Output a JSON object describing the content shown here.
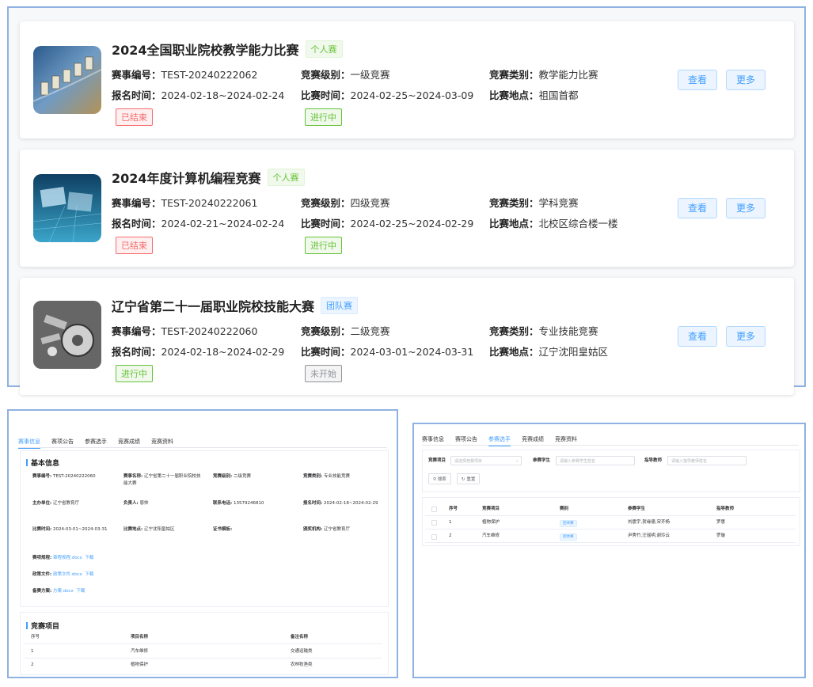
{
  "cards": [
    {
      "title": "2024全国职业院校教学能力比赛",
      "type_tag": "个人赛",
      "code_label": "赛事编号：",
      "code": "TEST-20240222062",
      "level_label": "竞赛级别：",
      "level": "一级竞赛",
      "category_label": "竞赛类别：",
      "category": "教学能力比赛",
      "reg_label": "报名时间：",
      "reg_time": "2024-02-18~2024-02-24",
      "match_label": "比赛时间：",
      "match_time": "2024-02-25~2024-03-09",
      "place_label": "比赛地点：",
      "place": "祖国首都",
      "reg_status": "已结束",
      "match_status": "进行中",
      "view_label": "查看",
      "more_label": "更多"
    },
    {
      "title": "2024年度计算机编程竞赛",
      "type_tag": "个人赛",
      "code_label": "赛事编号：",
      "code": "TEST-20240222061",
      "level_label": "竞赛级别：",
      "level": "四级竞赛",
      "category_label": "竞赛类别：",
      "category": "学科竞赛",
      "reg_label": "报名时间：",
      "reg_time": "2024-02-21~2024-02-24",
      "match_label": "比赛时间：",
      "match_time": "2024-02-25~2024-02-29",
      "place_label": "比赛地点：",
      "place": "北校区综合楼一楼",
      "reg_status": "已结束",
      "match_status": "进行中",
      "view_label": "查看",
      "more_label": "更多"
    },
    {
      "title": "辽宁省第二十一届职业院校技能大赛",
      "type_tag": "团队赛",
      "code_label": "赛事编号：",
      "code": "TEST-20240222060",
      "level_label": "竞赛级别：",
      "level": "二级竞赛",
      "category_label": "竞赛类别：",
      "category": "专业技能竞赛",
      "reg_label": "报名时间：",
      "reg_time": "2024-02-18~2024-02-29",
      "match_label": "比赛时间：",
      "match_time": "2024-03-01~2024-03-31",
      "place_label": "比赛地点：",
      "place": "辽宁沈阳皇姑区",
      "reg_status": "进行中",
      "match_status": "未开始",
      "view_label": "查看",
      "more_label": "更多"
    }
  ],
  "detail": {
    "tabs": [
      "赛事信息",
      "赛项公告",
      "参赛选手",
      "竞赛成绩",
      "竞赛资料"
    ],
    "basic_title": "基本信息",
    "rows": [
      [
        {
          "label": "赛事编号:",
          "value": "TEST-20240222060"
        },
        {
          "label": "赛事名称:",
          "value": "辽宁省第二十一届职业院校技能大赛"
        },
        {
          "label": "竞赛级别:",
          "value": "二级竞赛"
        },
        {
          "label": "竞赛类别:",
          "value": "专业技能竞赛"
        }
      ],
      [
        {
          "label": "主办单位:",
          "value": "辽宁省教育厅"
        },
        {
          "label": "负责人:",
          "value": "恩帅"
        },
        {
          "label": "联系电话:",
          "value": "13579246810"
        },
        {
          "label": "报名时间:",
          "value": "2024-02-18~2024-02-29"
        }
      ],
      [
        {
          "label": "比赛时间:",
          "value": "2024-03-01~2024-03-31"
        },
        {
          "label": "比赛地点:",
          "value": "辽宁沈阳皇姑区"
        },
        {
          "label": "证书模板:",
          "value": ""
        },
        {
          "label": "颁奖机构:",
          "value": "辽宁省教育厅"
        }
      ]
    ],
    "files": [
      {
        "label": "赛项规程:",
        "file": "章程规程.docx",
        "download": "下载"
      },
      {
        "label": "政策文件:",
        "file": "政策文件.docx",
        "download": "下载"
      },
      {
        "label": "备赛方案:",
        "file": "方案.docx",
        "download": "下载"
      }
    ],
    "items_title": "竞赛项目",
    "items_headers": [
      "序号",
      "项目名称",
      "备注名称"
    ],
    "items": [
      [
        "1",
        "汽车维修",
        "交通运输类"
      ],
      [
        "2",
        "植物保护",
        "农林牧渔类"
      ]
    ]
  },
  "players": {
    "tabs": [
      "赛事信息",
      "赛项公告",
      "参赛选手",
      "竞赛成绩",
      "竞赛资料"
    ],
    "filter_project_label": "竞赛项目",
    "filter_project_placeholder": "请选择竞赛项目",
    "filter_student_label": "参赛学生",
    "filter_student_placeholder": "请输入参赛学生姓名",
    "filter_teacher_label": "指导教师",
    "filter_teacher_placeholder": "请输入指导教师姓名",
    "search_label": "搜索",
    "reset_label": "重置",
    "headers": [
      "序号",
      "竞赛项目",
      "赛别",
      "参赛学生",
      "指导教师"
    ],
    "rows": [
      [
        "1",
        "植物保护",
        "团体赛",
        "刘震宇,贺缘德,宋齐杨",
        "罗惠"
      ],
      [
        "2",
        "汽车维修",
        "团体赛",
        "尹秀竹,汪瑶明,谢玲云",
        "罗璇"
      ]
    ]
  }
}
